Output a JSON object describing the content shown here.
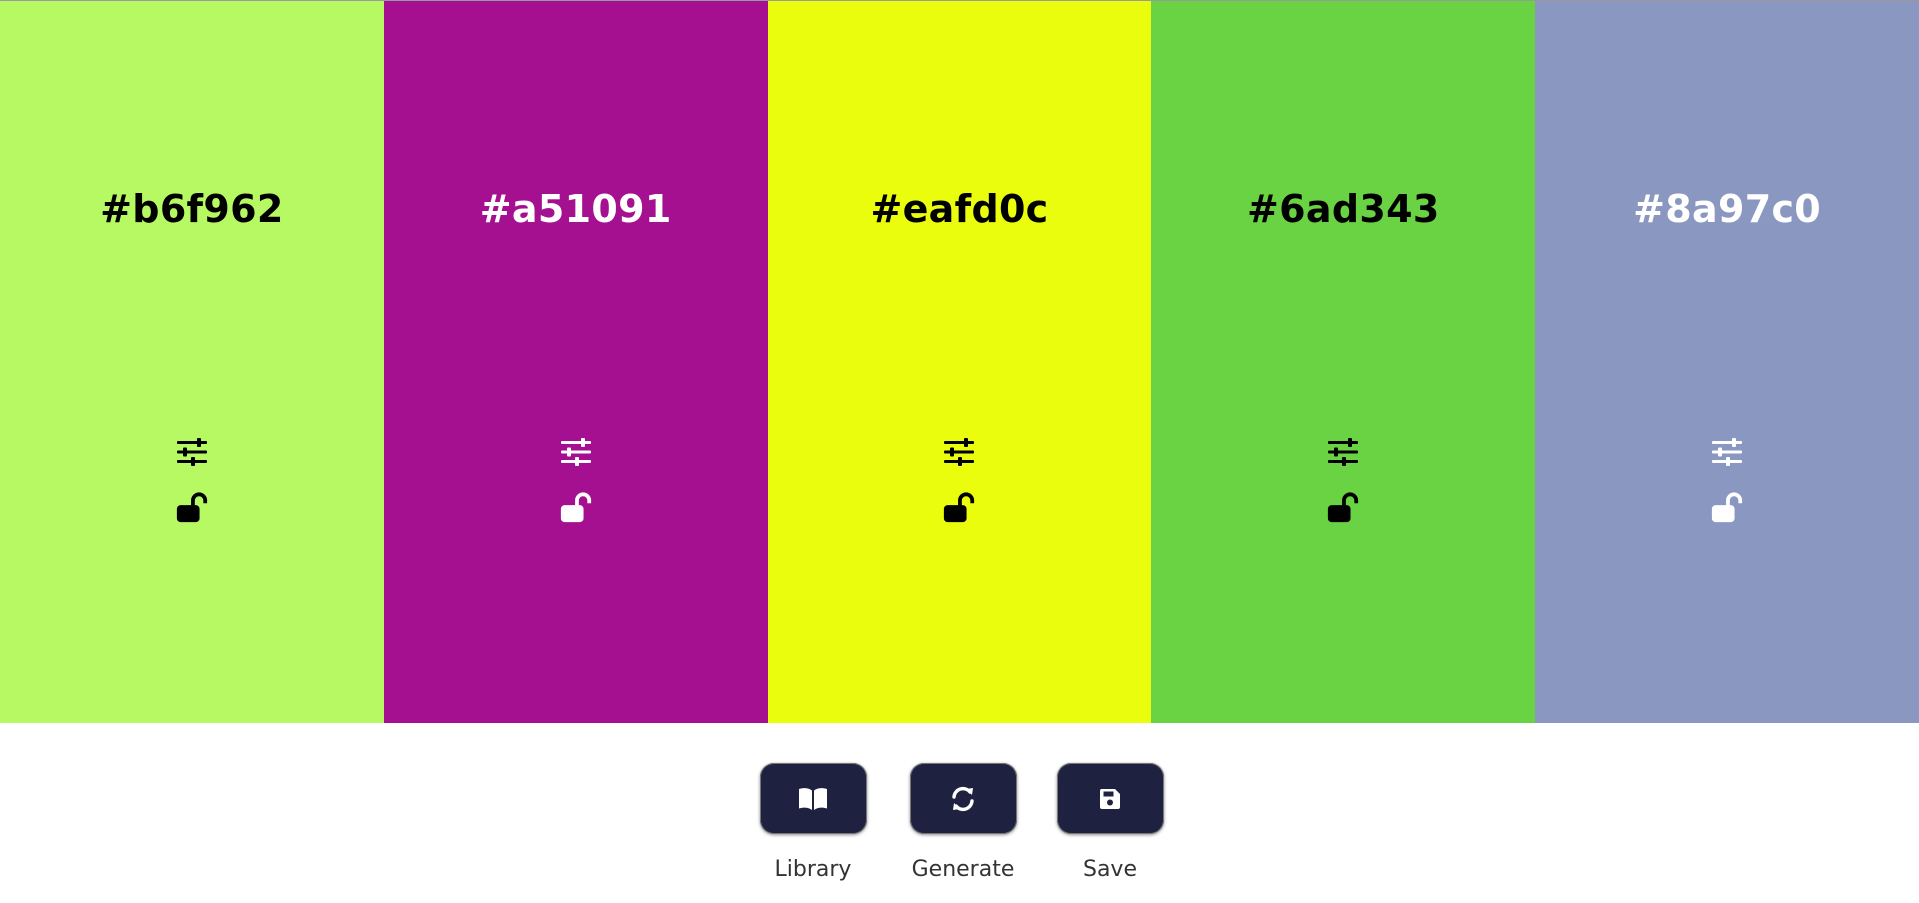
{
  "swatches": [
    {
      "hex": "#b6f962",
      "color": "#b6f962",
      "fg": "#000000"
    },
    {
      "hex": "#a51091",
      "color": "#a51091",
      "fg": "#ffffff"
    },
    {
      "hex": "#eafd0c",
      "color": "#eafd0c",
      "fg": "#000000"
    },
    {
      "hex": "#6ad343",
      "color": "#6ad343",
      "fg": "#000000"
    },
    {
      "hex": "#8a97c0",
      "color": "#8a97c0",
      "fg": "#ffffff"
    }
  ],
  "icons": {
    "adjust": "sliders-icon",
    "lock": "unlock-icon"
  },
  "toolbar": {
    "button_color": "#1f2140",
    "library_label": "Library",
    "library_icon": "book-icon",
    "generate_label": "Generate",
    "generate_icon": "refresh-icon",
    "save_label": "Save",
    "save_icon": "floppy-disk-icon"
  }
}
